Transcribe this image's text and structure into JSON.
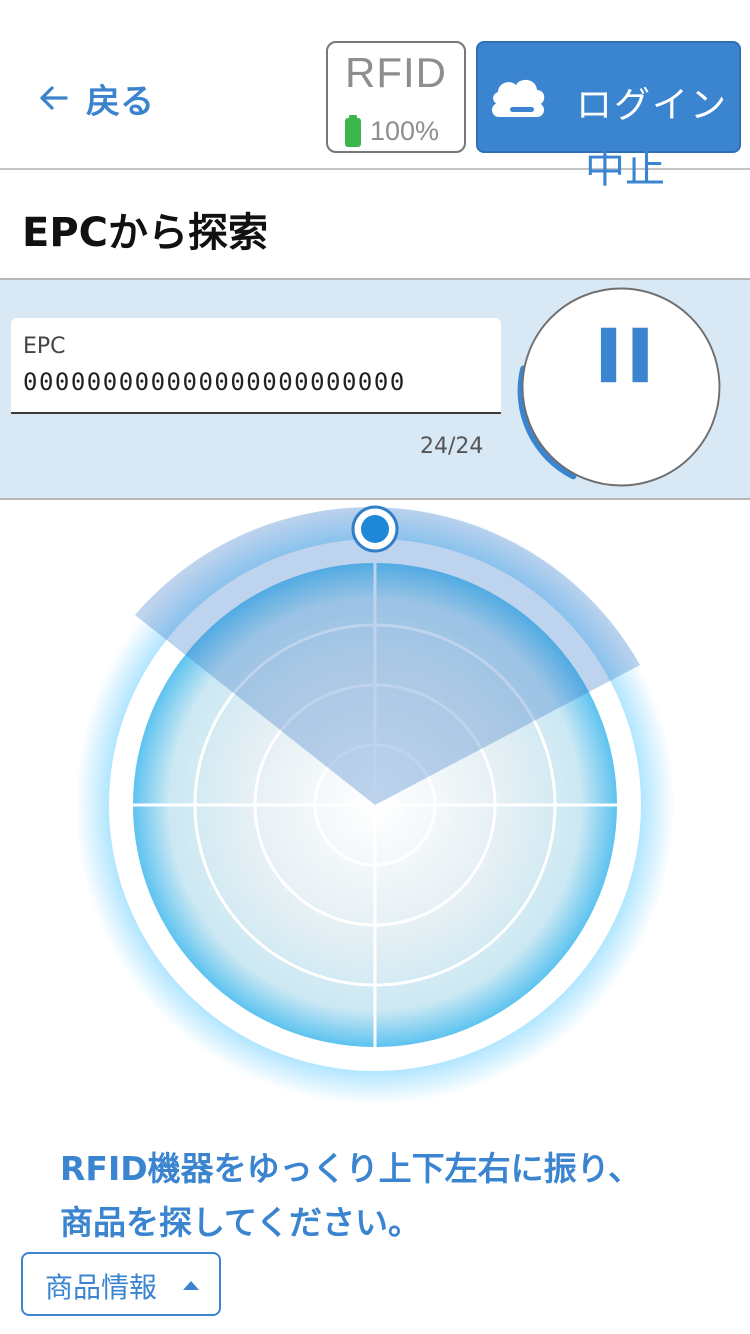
{
  "header": {
    "back_label": "戻る",
    "rfid_label": "RFID",
    "battery_percent": "100%",
    "battery_level": 1.0,
    "login_label": "ログイン"
  },
  "page": {
    "title": "EPCから探索"
  },
  "epc": {
    "label": "EPC",
    "value": "000000000000000000000000",
    "counter": "24/24"
  },
  "stop_button": {
    "label": "中止"
  },
  "instruction": {
    "line1": "RFID機器をゆっくり上下左右に振り、",
    "line2": "商品を探してください。"
  },
  "product_info": {
    "label": "商品情報"
  },
  "colors": {
    "accent": "#3a84d0",
    "band": "#d9e8f5",
    "battery": "#3cb54a",
    "radar_glow": "#6fd0ff"
  },
  "icons": {
    "back": "arrow-left-icon",
    "battery": "battery-icon",
    "cloud": "cloud-icon",
    "pause": "pause-icon",
    "caret": "caret-up-icon",
    "radar_marker": "radar-marker-icon"
  }
}
